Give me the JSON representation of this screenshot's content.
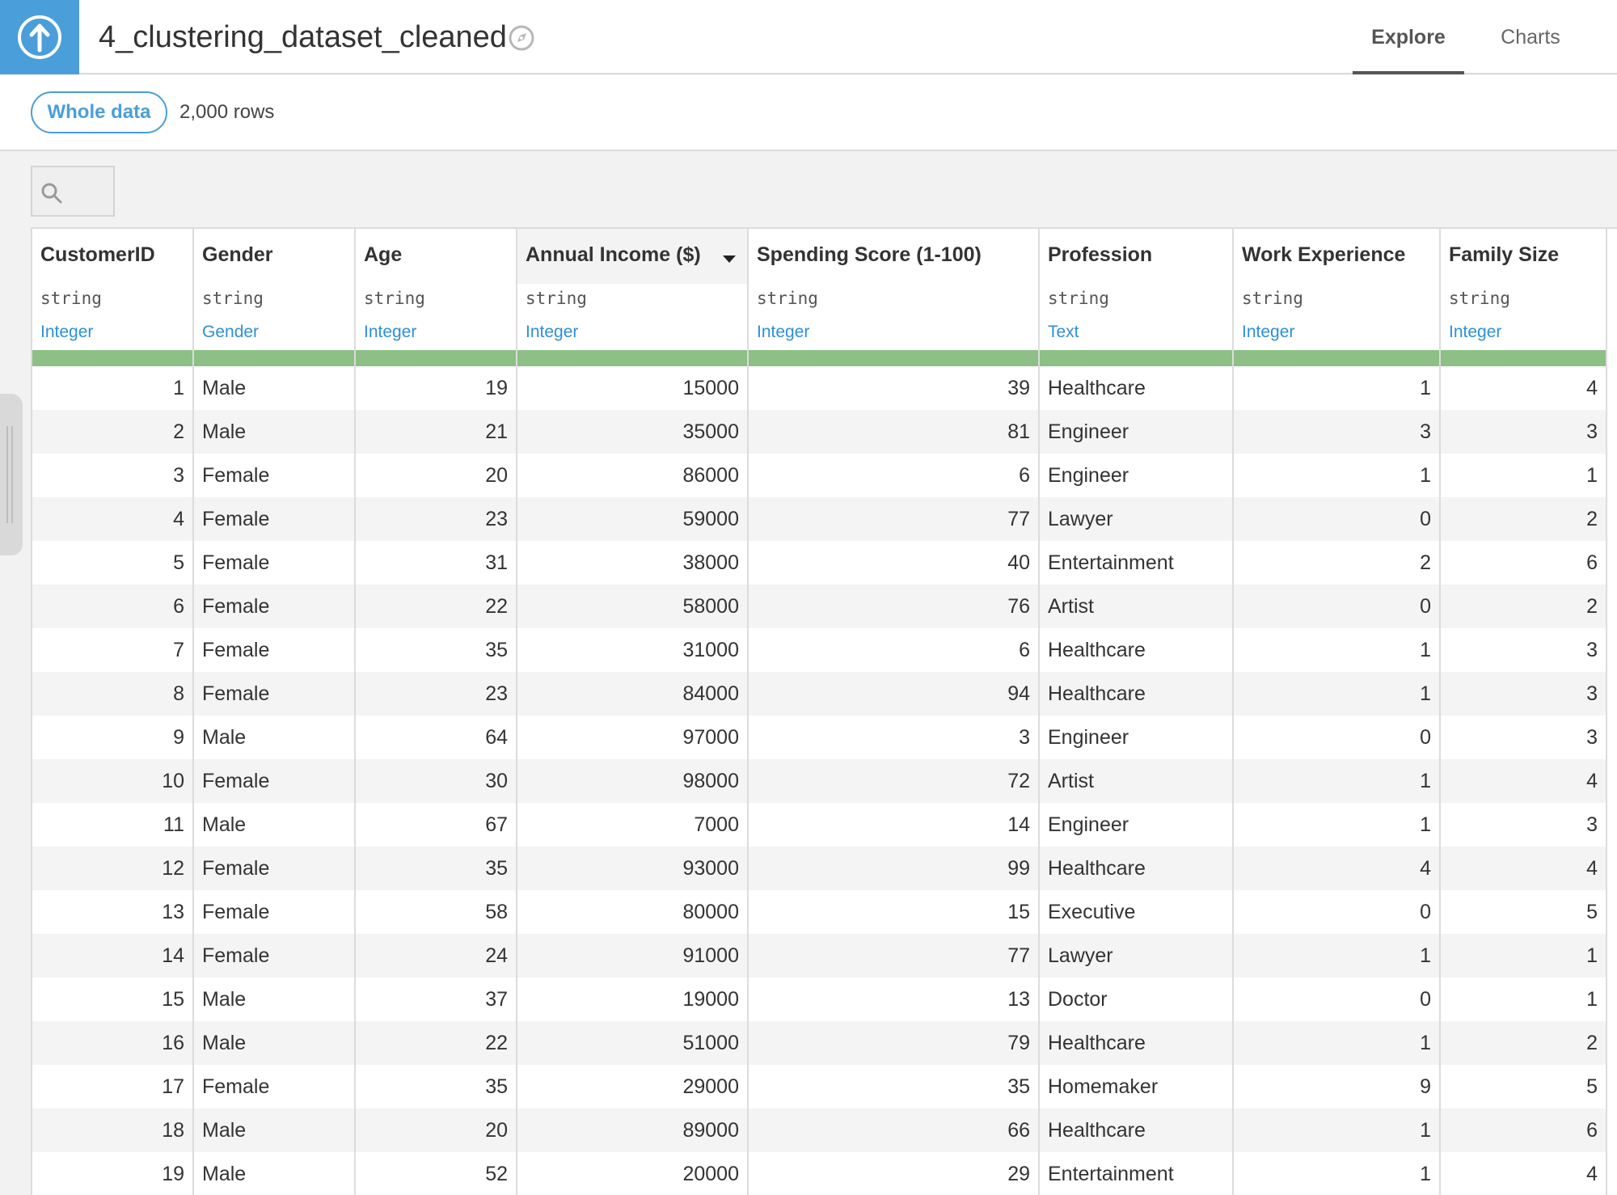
{
  "header": {
    "dataset_name": "4_clustering_dataset_cleaned",
    "tabs": [
      {
        "label": "Explore",
        "active": true
      },
      {
        "label": "Charts",
        "active": false
      }
    ]
  },
  "sample": {
    "button_label": "Whole data",
    "rows_label": "2,000 rows"
  },
  "search": {
    "placeholder": ""
  },
  "colors": {
    "accent": "#4a9ed9",
    "meaning": "#2f8fd6",
    "quality_ok": "#8cc085"
  },
  "table": {
    "columns": [
      {
        "name": "CustomerID",
        "storage": "string",
        "meaning": "Integer",
        "align": "num"
      },
      {
        "name": "Gender",
        "storage": "string",
        "meaning": "Gender",
        "align": "text"
      },
      {
        "name": "Age",
        "storage": "string",
        "meaning": "Integer",
        "align": "num"
      },
      {
        "name": "Annual Income ($)",
        "storage": "string",
        "meaning": "Integer",
        "align": "num",
        "sorted": true
      },
      {
        "name": "Spending Score (1-100)",
        "storage": "string",
        "meaning": "Integer",
        "align": "num"
      },
      {
        "name": "Profession",
        "storage": "string",
        "meaning": "Text",
        "align": "text"
      },
      {
        "name": "Work Experience",
        "storage": "string",
        "meaning": "Integer",
        "align": "num"
      },
      {
        "name": "Family Size",
        "storage": "string",
        "meaning": "Integer",
        "align": "num"
      }
    ],
    "rows": [
      [
        "1",
        "Male",
        "19",
        "15000",
        "39",
        "Healthcare",
        "1",
        "4"
      ],
      [
        "2",
        "Male",
        "21",
        "35000",
        "81",
        "Engineer",
        "3",
        "3"
      ],
      [
        "3",
        "Female",
        "20",
        "86000",
        "6",
        "Engineer",
        "1",
        "1"
      ],
      [
        "4",
        "Female",
        "23",
        "59000",
        "77",
        "Lawyer",
        "0",
        "2"
      ],
      [
        "5",
        "Female",
        "31",
        "38000",
        "40",
        "Entertainment",
        "2",
        "6"
      ],
      [
        "6",
        "Female",
        "22",
        "58000",
        "76",
        "Artist",
        "0",
        "2"
      ],
      [
        "7",
        "Female",
        "35",
        "31000",
        "6",
        "Healthcare",
        "1",
        "3"
      ],
      [
        "8",
        "Female",
        "23",
        "84000",
        "94",
        "Healthcare",
        "1",
        "3"
      ],
      [
        "9",
        "Male",
        "64",
        "97000",
        "3",
        "Engineer",
        "0",
        "3"
      ],
      [
        "10",
        "Female",
        "30",
        "98000",
        "72",
        "Artist",
        "1",
        "4"
      ],
      [
        "11",
        "Male",
        "67",
        "7000",
        "14",
        "Engineer",
        "1",
        "3"
      ],
      [
        "12",
        "Female",
        "35",
        "93000",
        "99",
        "Healthcare",
        "4",
        "4"
      ],
      [
        "13",
        "Female",
        "58",
        "80000",
        "15",
        "Executive",
        "0",
        "5"
      ],
      [
        "14",
        "Female",
        "24",
        "91000",
        "77",
        "Lawyer",
        "1",
        "1"
      ],
      [
        "15",
        "Male",
        "37",
        "19000",
        "13",
        "Doctor",
        "0",
        "1"
      ],
      [
        "16",
        "Male",
        "22",
        "51000",
        "79",
        "Healthcare",
        "1",
        "2"
      ],
      [
        "17",
        "Female",
        "35",
        "29000",
        "35",
        "Homemaker",
        "9",
        "5"
      ],
      [
        "18",
        "Male",
        "20",
        "89000",
        "66",
        "Healthcare",
        "1",
        "6"
      ],
      [
        "19",
        "Male",
        "52",
        "20000",
        "29",
        "Entertainment",
        "1",
        "4"
      ]
    ]
  }
}
